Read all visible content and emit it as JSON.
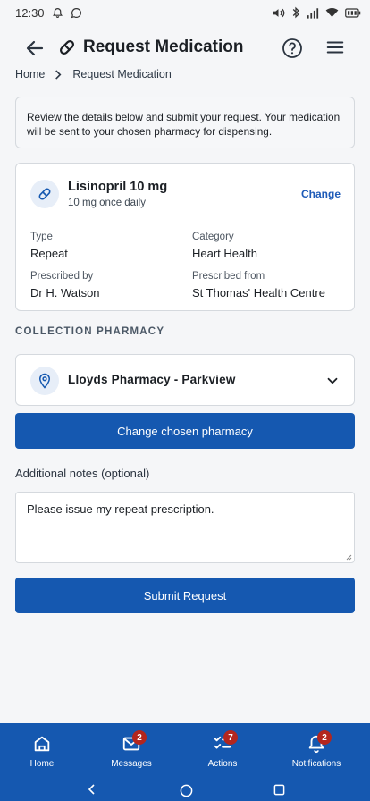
{
  "status_bar": {
    "time": "12:30"
  },
  "app_bar": {
    "title": "Request Medication"
  },
  "breadcrumb": {
    "home": "Home",
    "current": "Request Medication"
  },
  "intro": {
    "text": "Review the details below and submit your request. Your medication will be sent to your chosen pharmacy for dispensing."
  },
  "medication": {
    "name": "Lisinopril 10 mg",
    "dosage": "10 mg once daily",
    "change_label": "Change",
    "type_label": "Type",
    "type_value": "Repeat",
    "category_label": "Category",
    "category_value": "Heart Health",
    "prescribed_by_label": "Prescribed by",
    "prescribed_by_value": "Dr H. Watson",
    "prescribed_from_label": "Prescribed from",
    "prescribed_from_value": "St Thomas' Health Centre"
  },
  "collection": {
    "heading": "COLLECTION PHARMACY",
    "pharmacy_name": "Lloyds Pharmacy - Parkview",
    "change_button": "Change chosen pharmacy"
  },
  "notes": {
    "label": "Additional notes (optional)",
    "value": "Please issue my repeat prescription."
  },
  "submit_button": "Submit Request",
  "bottom_nav": {
    "home": {
      "label": "Home"
    },
    "messages": {
      "label": "Messages",
      "badge": "2"
    },
    "actions": {
      "label": "Actions",
      "badge": "7"
    },
    "notifications": {
      "label": "Notifications",
      "badge": "2"
    }
  },
  "colors": {
    "primary": "#1558b0",
    "badge": "#b3261e",
    "background": "#f5f6f8"
  }
}
